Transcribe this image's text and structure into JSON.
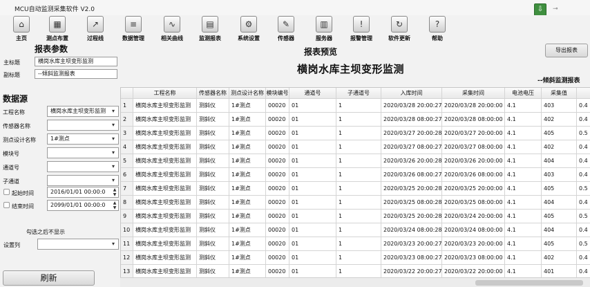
{
  "app": {
    "title": "MCU自动监测采集软件 V2.0"
  },
  "toolbar": [
    {
      "label": "主页",
      "icon": "home-icon",
      "glyph": "⌂"
    },
    {
      "label": "测点布置",
      "icon": "layout-icon",
      "glyph": "▦"
    },
    {
      "label": "过程线",
      "icon": "line-chart-icon",
      "glyph": "↗"
    },
    {
      "label": "数据管理",
      "icon": "database-icon",
      "glyph": "≡"
    },
    {
      "label": "相关曲线",
      "icon": "curve-icon",
      "glyph": "∿"
    },
    {
      "label": "监测报表",
      "icon": "report-icon",
      "glyph": "▤"
    },
    {
      "label": "系统设置",
      "icon": "gear-icon",
      "glyph": "⚙"
    },
    {
      "label": "传感器",
      "icon": "wrench-icon",
      "glyph": "✎"
    },
    {
      "label": "服务器",
      "icon": "server-icon",
      "glyph": "▥"
    },
    {
      "label": "报警管理",
      "icon": "alarm-icon",
      "glyph": "!"
    },
    {
      "label": "软件更新",
      "icon": "update-icon",
      "glyph": "↻"
    },
    {
      "label": "帮助",
      "icon": "help-icon",
      "glyph": "?"
    }
  ],
  "params": {
    "section_title": "报表参数",
    "main_title_label": "主标题",
    "main_title_value": "横岗水库主坝变形监测",
    "sub_title_label": "副标题",
    "sub_title_value": "--倾斜监测报表"
  },
  "datasource": {
    "section_title": "数据源",
    "project_label": "工程名称",
    "project_value": "横岗水库主坝变形监测",
    "sensor_label": "传感器名称",
    "sensor_value": "",
    "point_label": "测点设计名称",
    "point_value": "1#测点",
    "module_label": "模块号",
    "module_value": "",
    "channel_label": "通道号",
    "channel_value": "",
    "subchannel_label": "子通道",
    "subchannel_value": "",
    "start_label": "起始时间",
    "start_value": "2016/01/01 00:00:0",
    "end_label": "结束时间",
    "end_value": "2099/01/01 00:00:0",
    "hide_hint": "勾选之后不显示",
    "column_label": "设置列",
    "column_value": "",
    "refresh_label": "刷新"
  },
  "preview": {
    "heading": "报表预览",
    "title": "横岗水库主坝变形监测",
    "subtitle": "--倾斜监测报表",
    "export_label": "导出报表"
  },
  "table": {
    "columns": [
      "",
      "工程名称",
      "传感器名称",
      "测点设计名称",
      "模块编号",
      "通道号",
      "子通道号",
      "入库时间",
      "采集时间",
      "电池电压",
      "采集值",
      ""
    ],
    "rows": [
      [
        "1",
        "横岗水库主坝变形监测",
        "测斜仪",
        "1#测点",
        "00020",
        "01",
        "1",
        "2020/03/28 20:00:27",
        "2020/03/28 20:00:00",
        "4.1",
        "403",
        "0.4"
      ],
      [
        "2",
        "横岗水库主坝变形监测",
        "测斜仪",
        "1#测点",
        "00020",
        "01",
        "1",
        "2020/03/28 08:00:27",
        "2020/03/28 08:00:00",
        "4.1",
        "402",
        "0.4"
      ],
      [
        "3",
        "横岗水库主坝变形监测",
        "测斜仪",
        "1#测点",
        "00020",
        "01",
        "1",
        "2020/03/27 20:00:28",
        "2020/03/27 20:00:00",
        "4.1",
        "405",
        "0.5"
      ],
      [
        "4",
        "横岗水库主坝变形监测",
        "测斜仪",
        "1#测点",
        "00020",
        "01",
        "1",
        "2020/03/27 08:00:27",
        "2020/03/27 08:00:00",
        "4.1",
        "402",
        "0.4"
      ],
      [
        "5",
        "横岗水库主坝变形监测",
        "测斜仪",
        "1#测点",
        "00020",
        "01",
        "1",
        "2020/03/26 20:00:28",
        "2020/03/26 20:00:00",
        "4.1",
        "404",
        "0.4"
      ],
      [
        "6",
        "横岗水库主坝变形监测",
        "测斜仪",
        "1#测点",
        "00020",
        "01",
        "1",
        "2020/03/26 08:00:27",
        "2020/03/26 08:00:00",
        "4.1",
        "403",
        "0.4"
      ],
      [
        "7",
        "横岗水库主坝变形监测",
        "测斜仪",
        "1#测点",
        "00020",
        "01",
        "1",
        "2020/03/25 20:00:28",
        "2020/03/25 20:00:00",
        "4.1",
        "405",
        "0.5"
      ],
      [
        "8",
        "横岗水库主坝变形监测",
        "测斜仪",
        "1#测点",
        "00020",
        "01",
        "1",
        "2020/03/25 08:00:28",
        "2020/03/25 08:00:00",
        "4.1",
        "404",
        "0.4"
      ],
      [
        "9",
        "横岗水库主坝变形监测",
        "测斜仪",
        "1#测点",
        "00020",
        "01",
        "1",
        "2020/03/25 20:00:28",
        "2020/03/24 20:00:00",
        "4.1",
        "405",
        "0.5"
      ],
      [
        "10",
        "横岗水库主坝变形监测",
        "测斜仪",
        "1#测点",
        "00020",
        "01",
        "1",
        "2020/03/24 08:00:28",
        "2020/03/24 08:00:00",
        "4.1",
        "404",
        "0.4"
      ],
      [
        "11",
        "横岗水库主坝变形监测",
        "测斜仪",
        "1#测点",
        "00020",
        "01",
        "1",
        "2020/03/23 20:00:27",
        "2020/03/23 20:00:00",
        "4.1",
        "405",
        "0.5"
      ],
      [
        "12",
        "横岗水库主坝变形监测",
        "测斜仪",
        "1#测点",
        "00020",
        "01",
        "1",
        "2020/03/23 08:00:27",
        "2020/03/23 08:00:00",
        "4.1",
        "402",
        "0.4"
      ],
      [
        "13",
        "横岗水库主坝变形监测",
        "测斜仪",
        "1#测点",
        "00020",
        "01",
        "1",
        "2020/03/22 20:00:27",
        "2020/03/22 20:00:00",
        "4.1",
        "401",
        "0.4"
      ]
    ]
  }
}
